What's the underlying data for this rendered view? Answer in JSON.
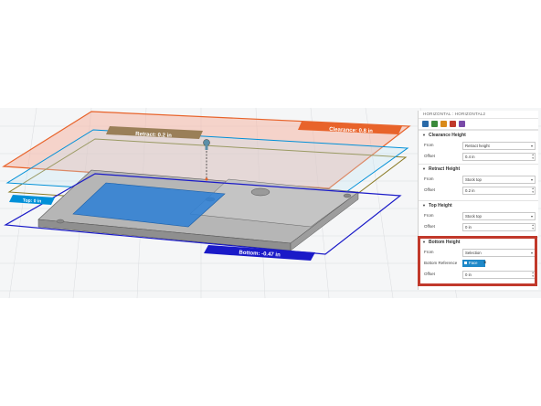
{
  "colors": {
    "clearance": "#e8632a",
    "retract": "#0090d8",
    "top": "#8a7a24",
    "bottom": "#1a1ac8",
    "part": "#a9a9a9",
    "stock_face": "#2c7fd6",
    "highlight": "#c1392b",
    "face_button": "#1e88c8"
  },
  "viewport": {
    "clearance_label": "Clearance: 0.8 in",
    "retract_label": "Retract: 0.2 in",
    "top_label": "Top: 0 in",
    "bottom_label": "Bottom: -0.47 in"
  },
  "panel": {
    "title": "HORIZONTAL : HORIZONTAL2",
    "tabs": [
      "tool-tab-icon",
      "geometry-tab-icon",
      "heights-tab-icon",
      "passes-tab-icon",
      "linking-tab-icon"
    ],
    "clearance": {
      "heading": "Clearance Height",
      "from_label": "From",
      "from_value": "Retract height",
      "offset_label": "Offset",
      "offset_value": "0.4 in"
    },
    "retract": {
      "heading": "Retract Height",
      "from_label": "From",
      "from_value": "Stock top",
      "offset_label": "Offset",
      "offset_value": "0.2 in"
    },
    "top": {
      "heading": "Top Height",
      "from_label": "From",
      "from_value": "Stock top",
      "offset_label": "Offset",
      "offset_value": "0 in"
    },
    "bottom": {
      "heading": "Bottom Height",
      "from_label": "From",
      "from_value": "Selection",
      "ref_label": "Bottom Reference",
      "ref_button": "Face",
      "offset_label": "Offset",
      "offset_value": "0 in"
    }
  }
}
